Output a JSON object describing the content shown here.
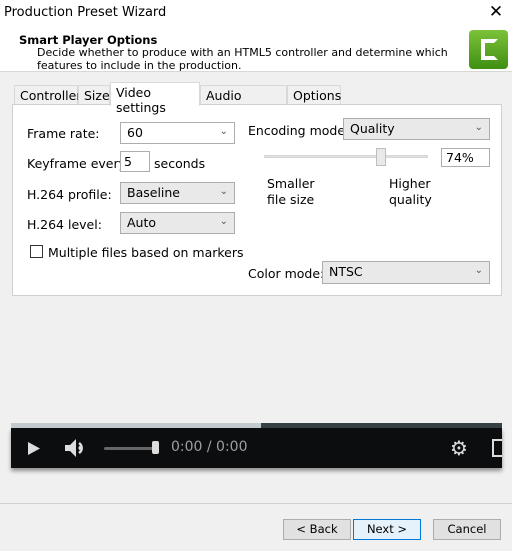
{
  "window": {
    "title": "Production Preset Wizard",
    "close_icon": "close-icon"
  },
  "header": {
    "title": "Smart Player Options",
    "description": "Decide whether to produce with an HTML5 controller and determine which features to include in the production.",
    "logo": "camtasia-logo"
  },
  "tabs": [
    {
      "label": "Controller"
    },
    {
      "label": "Size"
    },
    {
      "label": "Video settings",
      "selected": true
    },
    {
      "label": "Audio settings"
    },
    {
      "label": "Options"
    }
  ],
  "video": {
    "frame_rate_label": "Frame rate:",
    "frame_rate": "60",
    "keyframe_label": "Keyframe every:",
    "keyframe": "5",
    "keyframe_unit": "seconds",
    "profile_label": "H.264 profile:",
    "profile": "Baseline",
    "level_label": "H.264 level:",
    "level": "Auto",
    "multiple_files_label": "Multiple files based on markers",
    "multiple_files_checked": false,
    "encoding_label": "Encoding mode:",
    "encoding": "Quality",
    "quality_percent": 74,
    "quality_text": "74%",
    "smaller_label": "Smaller file size",
    "higher_label": "Higher quality",
    "color_label": "Color mode:",
    "color": "NTSC"
  },
  "player": {
    "time": "0:00 / 0:00",
    "progress_fraction": 0.51,
    "volume_fraction": 1.0
  },
  "buttons": {
    "back": "< Back",
    "next": "Next >",
    "cancel": "Cancel"
  }
}
